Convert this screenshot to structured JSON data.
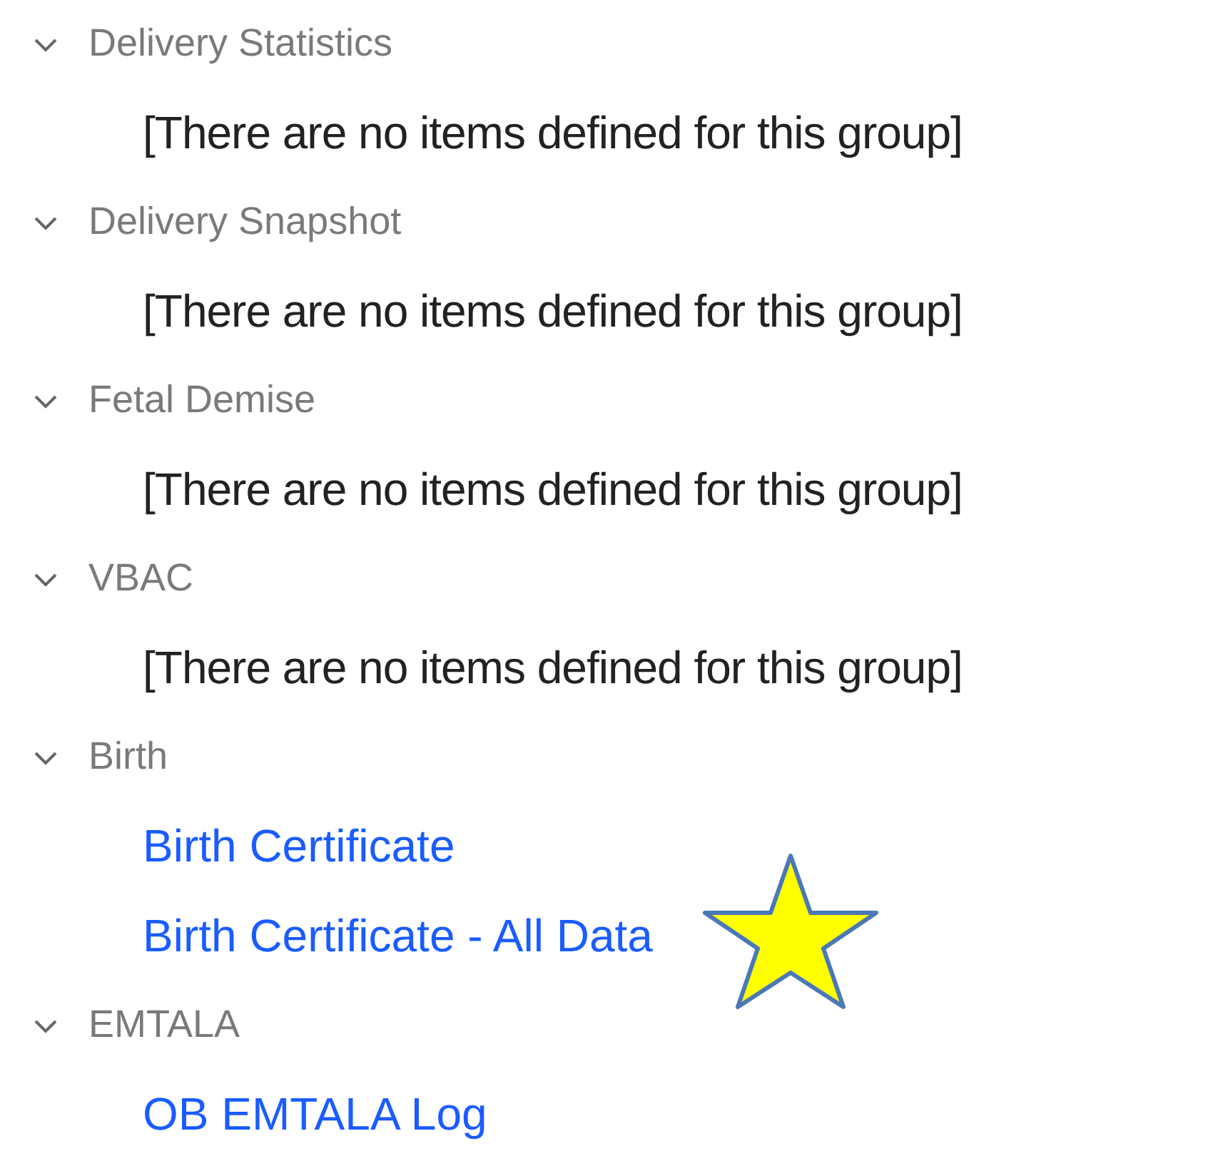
{
  "groups": [
    {
      "title": "Delivery Statistics",
      "expanded": true,
      "items": [
        {
          "kind": "empty",
          "text": "[There are no items defined for this group]"
        }
      ]
    },
    {
      "title": "Delivery Snapshot",
      "expanded": true,
      "items": [
        {
          "kind": "empty",
          "text": "[There are no items defined for this group]"
        }
      ]
    },
    {
      "title": "Fetal Demise",
      "expanded": true,
      "items": [
        {
          "kind": "empty",
          "text": "[There are no items defined for this group]"
        }
      ]
    },
    {
      "title": "VBAC",
      "expanded": true,
      "items": [
        {
          "kind": "empty",
          "text": "[There are no items defined for this group]"
        }
      ]
    },
    {
      "title": "Birth",
      "expanded": true,
      "items": [
        {
          "kind": "link",
          "text": "Birth Certificate"
        },
        {
          "kind": "link",
          "text": "Birth Certificate - All Data",
          "starred": true
        }
      ]
    },
    {
      "title": "EMTALA",
      "expanded": true,
      "items": [
        {
          "kind": "link",
          "text": "OB EMTALA Log"
        }
      ]
    }
  ]
}
